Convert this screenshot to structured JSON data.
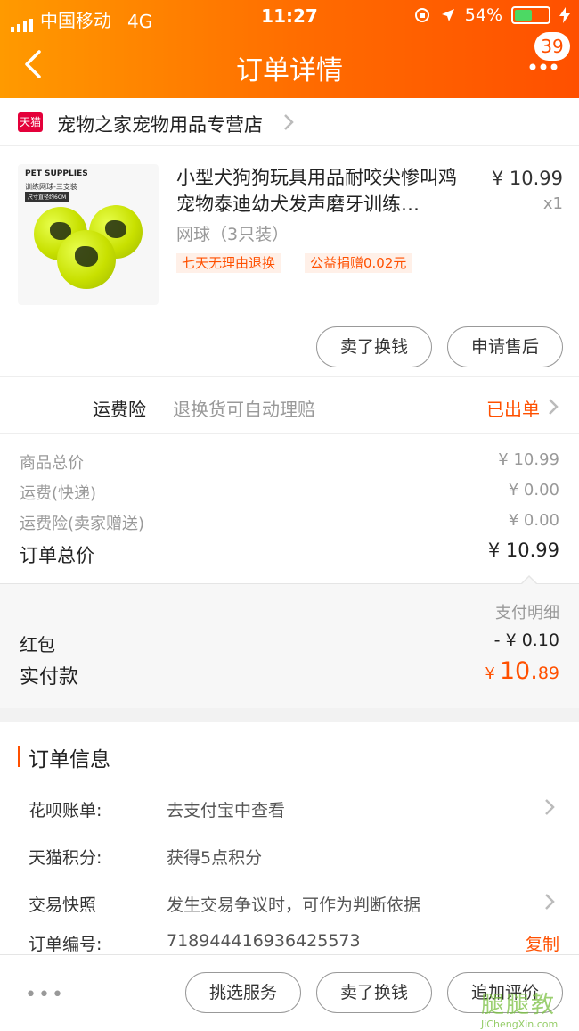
{
  "status_bar": {
    "carrier": "中国移动",
    "network": "4G",
    "time": "11:27",
    "battery": "54%",
    "battery_level": 0.54
  },
  "nav": {
    "title": "订单详情",
    "back_icon": "chevron-left-icon",
    "more_icon": "more-dots-icon",
    "badge_count": "39"
  },
  "shop": {
    "logo_text": "天猫",
    "name": "宠物之家宠物用品专营店"
  },
  "product": {
    "image_caption_1": "PET SUPPLIES",
    "image_caption_2": "训练网球-三支装",
    "image_caption_3": "尺寸直径约6CM",
    "title": "小型犬狗狗玩具用品耐咬尖惨叫鸡宠物泰迪幼犬发声磨牙训练…",
    "price": "¥ 10.99",
    "quantity": "x1",
    "spec": "网球（3只装）",
    "tags": [
      "七天无理由退换",
      "公益捐赠0.02元"
    ],
    "buttons": [
      "卖了换钱",
      "申请售后"
    ]
  },
  "insurance": {
    "label": "运费险",
    "desc": "退换货可自动理赔",
    "status": "已出单"
  },
  "costs": {
    "rows": [
      {
        "label": "商品总价",
        "value": "¥ 10.99"
      },
      {
        "label": "运费(快递)",
        "value": "¥ 0.00"
      },
      {
        "label": "运费险(卖家赠送)",
        "value": "¥ 0.00"
      }
    ],
    "total_label": "订单总价",
    "total_value": "¥ 10.99"
  },
  "payment": {
    "detail_link": "支付明细",
    "red_packet_label": "红包",
    "red_packet_value": "- ¥ 0.10",
    "paid_label": "实付款",
    "paid_currency": "¥",
    "paid_int": "10.",
    "paid_dec": "89"
  },
  "order_info": {
    "heading": "订单信息",
    "rows": [
      {
        "label": "花呗账单:",
        "value": "去支付宝中查看"
      },
      {
        "label": "天猫积分:",
        "value": "获得5点积分"
      },
      {
        "label": "交易快照",
        "value": "发生交易争议时，可作为判断依据"
      },
      {
        "label": "订单编号:",
        "value": "718944416936425573"
      }
    ],
    "copy_label": "复制"
  },
  "footer": {
    "more": "•••",
    "buttons": [
      "挑选服务",
      "卖了换钱",
      "追加评价"
    ]
  },
  "watermark": {
    "cn": "腿腿教",
    "en": "JiChengXin.com"
  },
  "colors": {
    "accent": "#ff5000",
    "header_start": "#ff9a00",
    "header_end": "#ff5000"
  }
}
